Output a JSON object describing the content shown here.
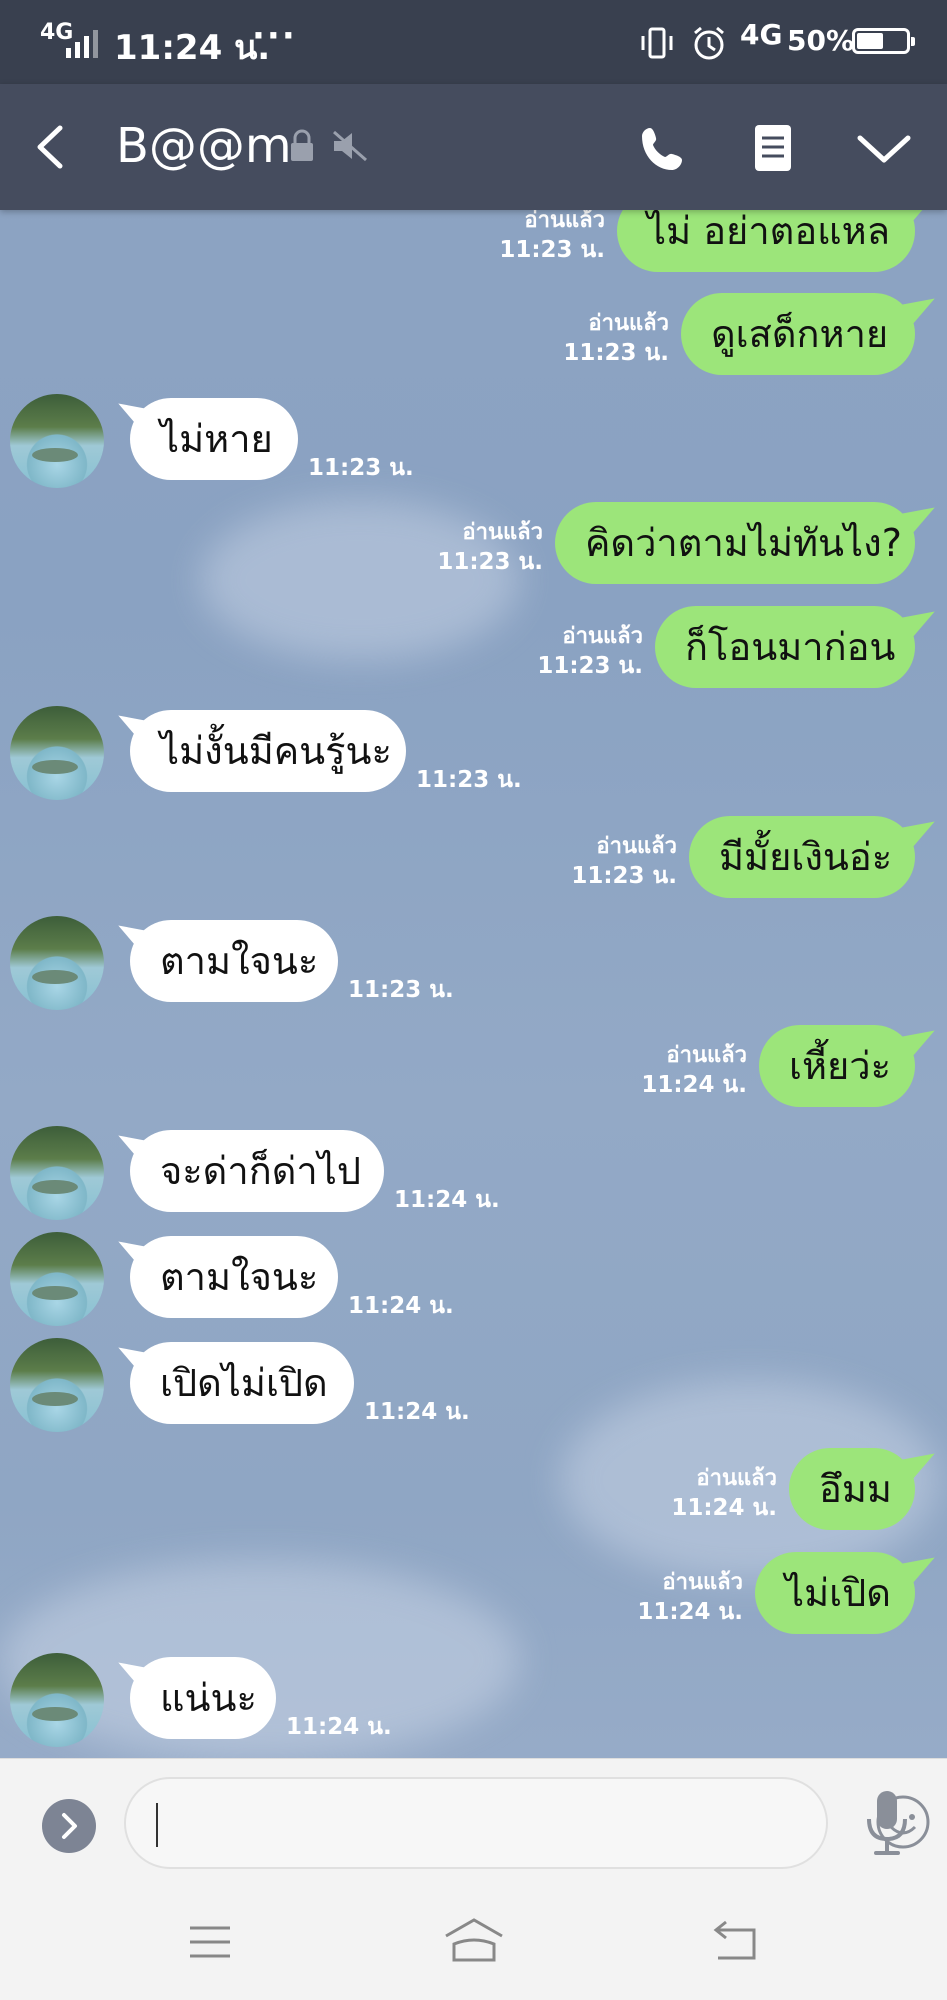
{
  "status_bar": {
    "network": "4G",
    "time": "11:24 น.",
    "dots": "···",
    "data_network": "4G",
    "battery": "50%"
  },
  "header": {
    "contact_name": "B@@m",
    "icons": [
      "back-icon",
      "lock-icon",
      "mute-icon",
      "call-icon",
      "notes-icon",
      "chevron-down-icon"
    ]
  },
  "messages": [
    {
      "side": "out",
      "text": "ไม่ อย่าตอแหล",
      "read": "อ่านแล้ว",
      "time": "11:23 น."
    },
    {
      "side": "out",
      "text": "ดูเสด็กหาย",
      "read": "อ่านแล้ว",
      "time": "11:23 น."
    },
    {
      "side": "in",
      "text": "ไม่หาย",
      "time": "11:23 น."
    },
    {
      "side": "out",
      "text": "คิดว่าตามไม่ทันไง?",
      "read": "อ่านแล้ว",
      "time": "11:23 น."
    },
    {
      "side": "out",
      "text": "ก็โอนมาก่อน",
      "read": "อ่านแล้ว",
      "time": "11:23 น."
    },
    {
      "side": "in",
      "text": "ไม่งั้นมีคนรู้นะ",
      "time": "11:23 น."
    },
    {
      "side": "out",
      "text": "มีมั้ยเงินอ่ะ",
      "read": "อ่านแล้ว",
      "time": "11:23 น."
    },
    {
      "side": "in",
      "text": "ตามใจนะ",
      "time": "11:23 น."
    },
    {
      "side": "out",
      "text": "เหี้ยว่ะ",
      "read": "อ่านแล้ว",
      "time": "11:24 น."
    },
    {
      "side": "in",
      "text": "จะด่าก็ด่าไป",
      "time": "11:24 น."
    },
    {
      "side": "in",
      "text": "ตามใจนะ",
      "time": "11:24 น."
    },
    {
      "side": "in",
      "text": "เปิดไม่เปิด",
      "time": "11:24 น."
    },
    {
      "side": "out",
      "text": "อึมม",
      "read": "อ่านแล้ว",
      "time": "11:24 น."
    },
    {
      "side": "out",
      "text": "ไม่เปิด",
      "read": "อ่านแล้ว",
      "time": "11:24 น."
    },
    {
      "side": "in",
      "text": "แน่นะ",
      "time": "11:24 น."
    }
  ],
  "input_bar": {
    "text_value": "",
    "icons": [
      "chevron-right-icon",
      "emoji-icon",
      "microphone-icon"
    ]
  },
  "nav_bar": {
    "icons": [
      "menu-icon",
      "home-icon",
      "back-nav-icon"
    ]
  },
  "colors": {
    "status_bar": "#39404f",
    "header": "#454c5e",
    "outgoing_bubble": "#9ce57a",
    "incoming_bubble": "#ffffff",
    "chat_background": "#8ea4c2"
  }
}
